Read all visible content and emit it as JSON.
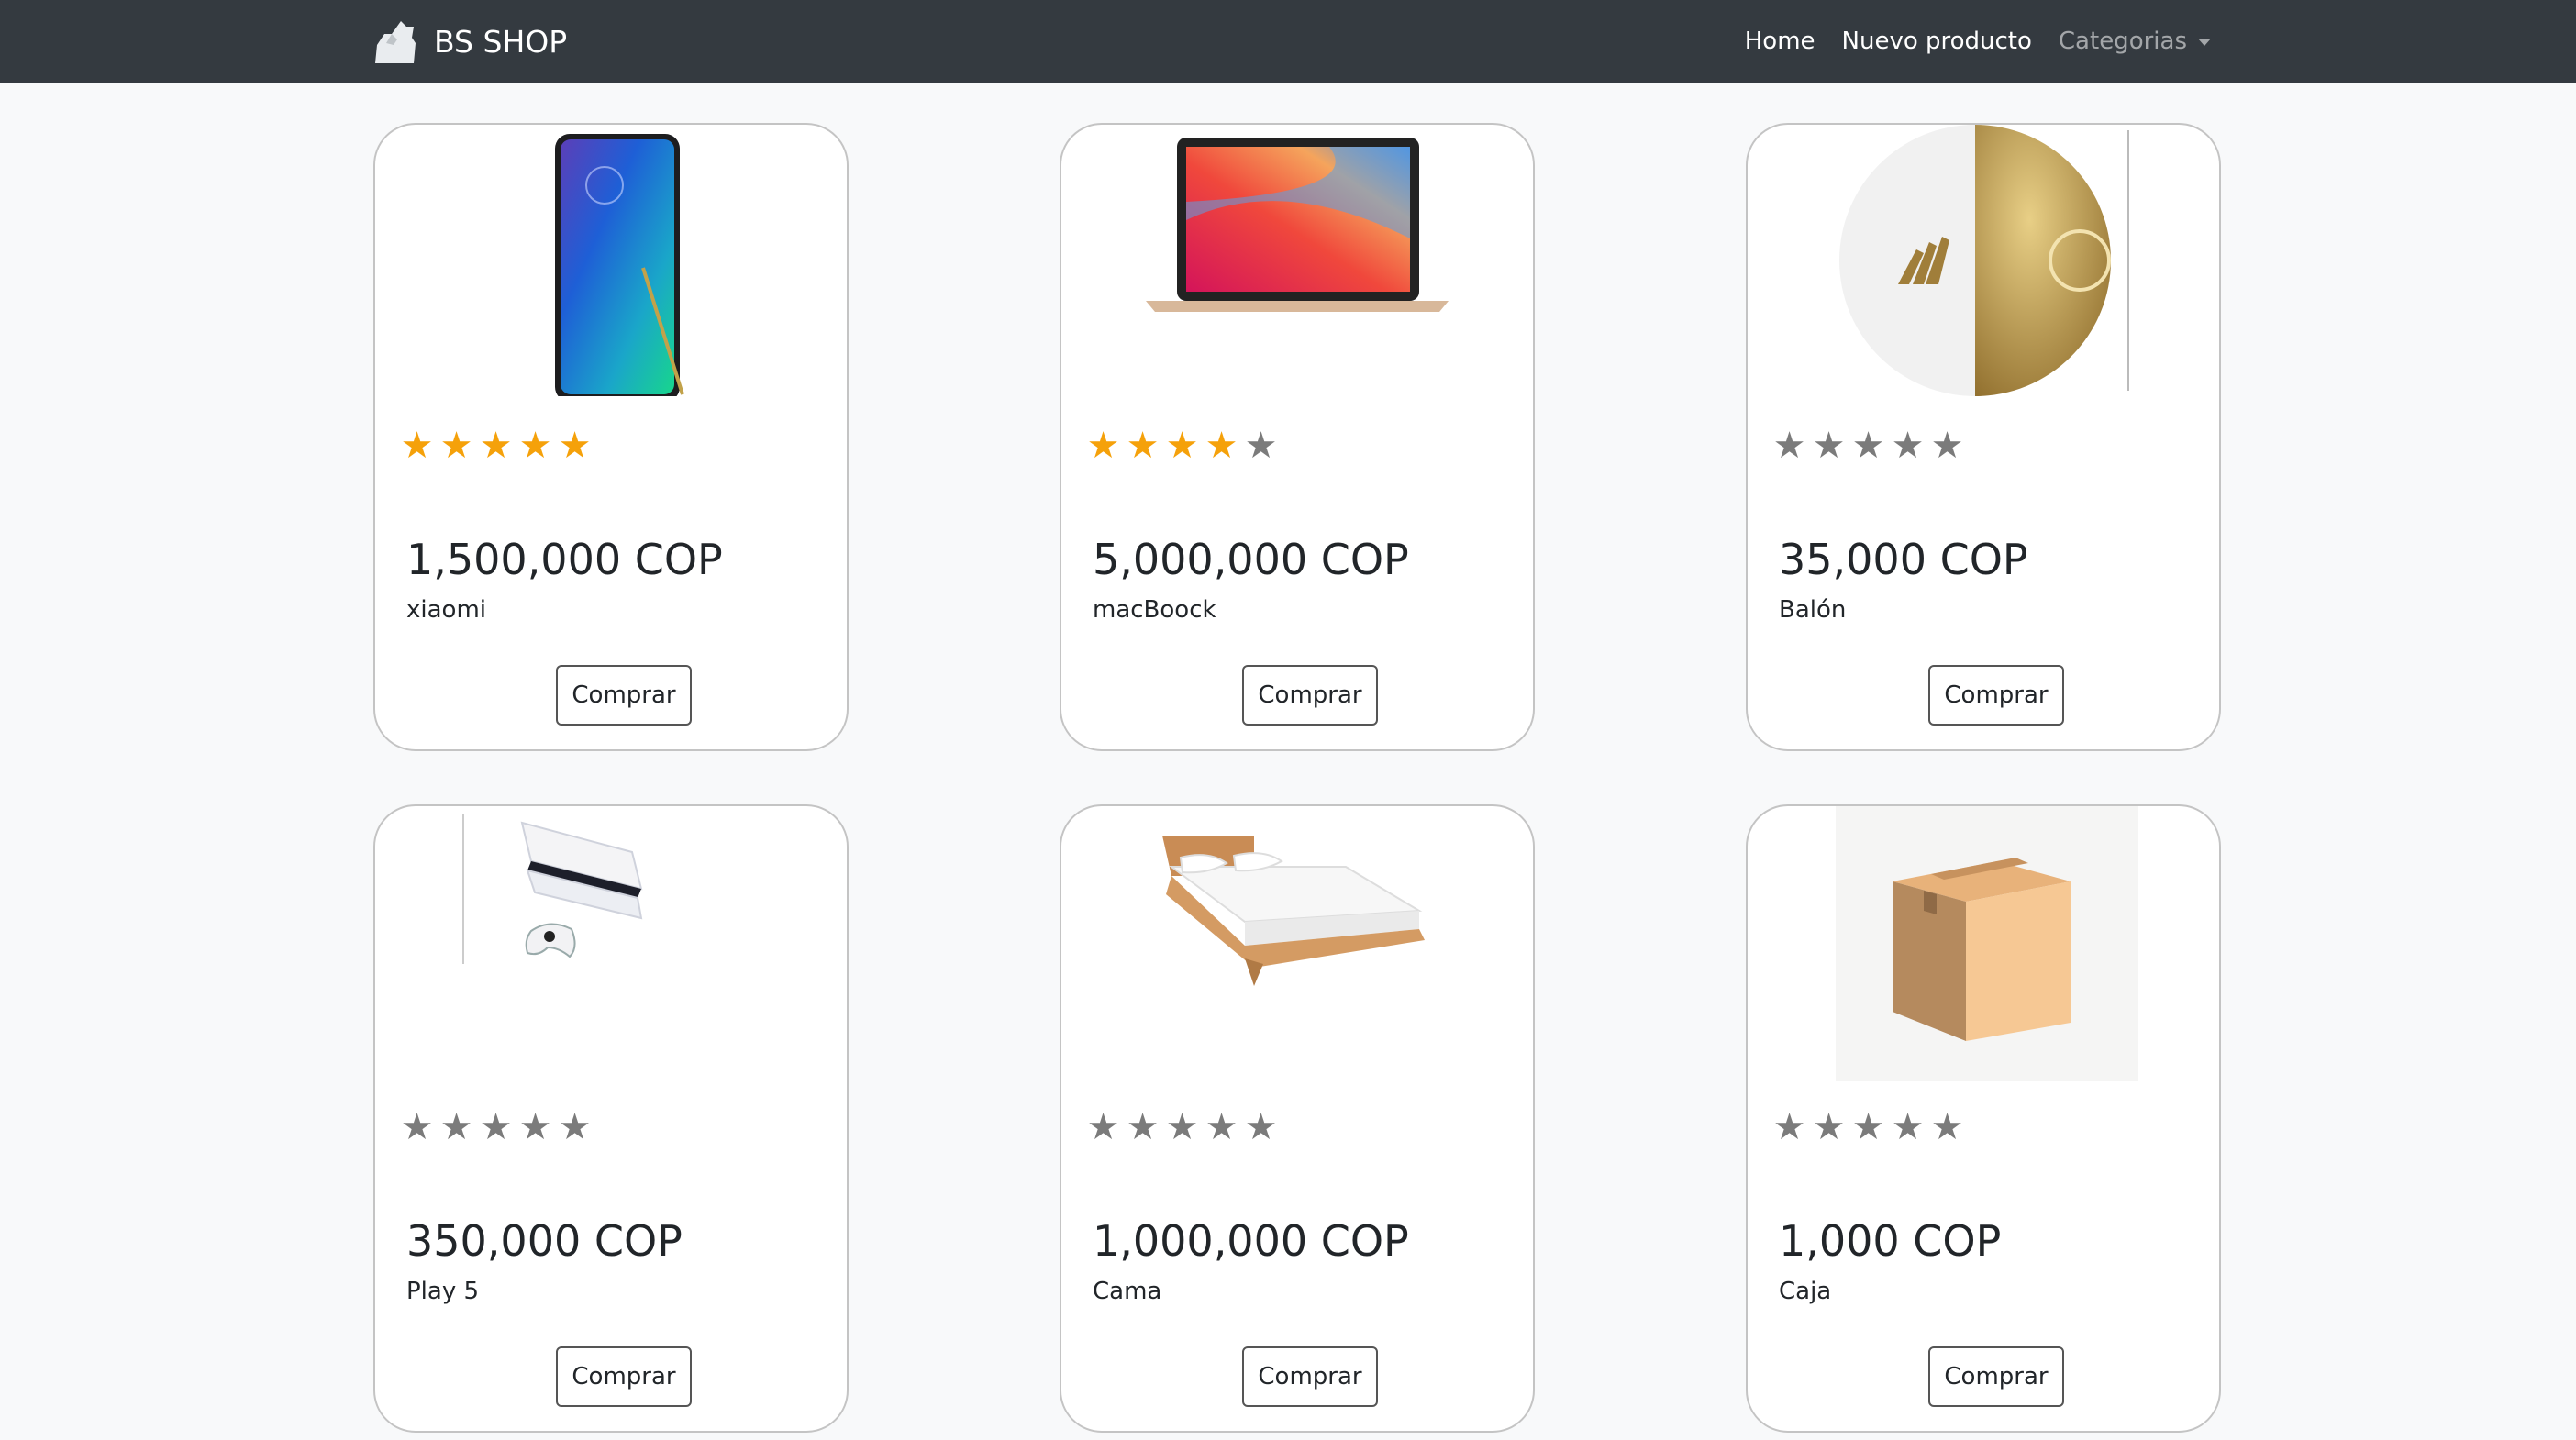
{
  "navbar": {
    "brand": "BS SHOP",
    "brand_icon": "shop-logo-icon",
    "links": [
      {
        "label": "Home"
      },
      {
        "label": "Nuevo producto"
      },
      {
        "label": "Categorias"
      }
    ]
  },
  "products": [
    {
      "name": "xiaomi",
      "price": "1,500,000 COP",
      "rating": 5,
      "rating_max": 5,
      "button": "Comprar",
      "image_icon": "smartphone-image"
    },
    {
      "name": "macBoock",
      "price": "5,000,000 COP",
      "rating": 4,
      "rating_max": 5,
      "button": "Comprar",
      "image_icon": "laptop-image"
    },
    {
      "name": "Balón",
      "price": "35,000 COP",
      "rating": 0,
      "rating_max": 5,
      "button": "Comprar",
      "image_icon": "soccer-ball-image"
    },
    {
      "name": "Play 5",
      "price": "350,000 COP",
      "rating": 0,
      "rating_max": 5,
      "button": "Comprar",
      "image_icon": "game-console-image"
    },
    {
      "name": "Cama",
      "price": "1,000,000 COP",
      "rating": 0,
      "rating_max": 5,
      "button": "Comprar",
      "image_icon": "bed-image"
    },
    {
      "name": "Caja",
      "price": "1,000 COP",
      "rating": 0,
      "rating_max": 5,
      "button": "Comprar",
      "image_icon": "cardboard-box-image"
    }
  ],
  "colors": {
    "navbar_bg": "#343a40",
    "star_filled": "#f5a10a",
    "star_empty": "#7b7b7b",
    "page_bg": "#f8f9fa"
  }
}
